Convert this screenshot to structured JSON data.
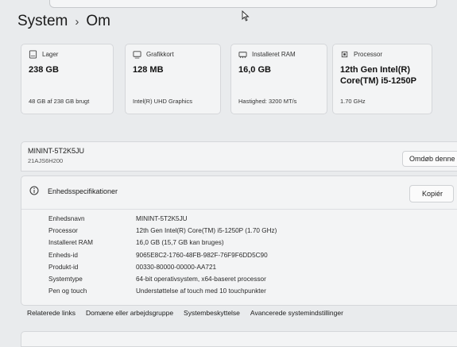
{
  "breadcrumb": {
    "parent": "System",
    "separator": "›",
    "current": "Om"
  },
  "cards": [
    {
      "label": "Lager",
      "value": "238 GB",
      "sub": "48 GB af 238 GB brugt",
      "icon": "storage-icon"
    },
    {
      "label": "Grafikkort",
      "value": "128 MB",
      "sub": "Intel(R) UHD Graphics",
      "icon": "graphics-card-icon"
    },
    {
      "label": "Installeret RAM",
      "value": "16,0 GB",
      "sub": "Hastighed: 3200 MT/s",
      "icon": "ram-icon"
    },
    {
      "label": "Processor",
      "value_line1": "12th Gen Intel(R)",
      "value_line2": "Core(TM) i5-1250P",
      "sub": "1.70 GHz",
      "icon": "processor-icon"
    }
  ],
  "device": {
    "name": "MININT-5T2K5JU",
    "model": "21AJS6H200",
    "rename_button": "Omdøb denne p"
  },
  "specs": {
    "title": "Enhedsspecifikationer",
    "copy_button": "Kopiér",
    "rows": [
      {
        "key": "Enhedsnavn",
        "value": "MININT-5T2K5JU"
      },
      {
        "key": "Processor",
        "value": "12th Gen Intel(R) Core(TM) i5-1250P (1.70 GHz)"
      },
      {
        "key": "Installeret RAM",
        "value": "16,0 GB (15,7 GB kan bruges)"
      },
      {
        "key": "Enheds-id",
        "value": "9065E8C2-1760-48FB-982F-76F9F6DD5C90"
      },
      {
        "key": "Produkt-id",
        "value": "00330-80000-00000-AA721"
      },
      {
        "key": "Systemtype",
        "value": "64-bit operativsystem, x64-baseret processor"
      },
      {
        "key": "Pen og touch",
        "value": "Understøttelse af touch med 10 touchpunkter"
      }
    ]
  },
  "related_links": {
    "label": "Relaterede links",
    "items": [
      "Domæne eller arbejdsgruppe",
      "Systembeskyttelse",
      "Avancerede systemindstillinger"
    ]
  }
}
